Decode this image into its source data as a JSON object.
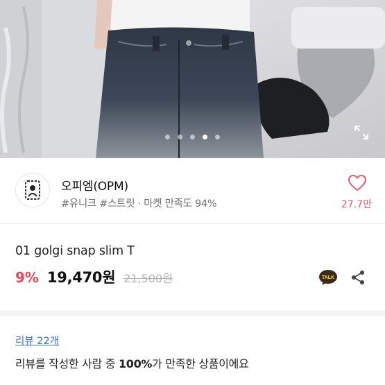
{
  "gallery": {
    "slide_count": 5,
    "active_index": 3,
    "expand_icon": "expand-arrows-icon"
  },
  "shop": {
    "name": "오피엠(OPM)",
    "tags": "#유니크 #스트릿",
    "satisfaction": "마켓 만족도 94%",
    "like_count": "27.7만",
    "like_icon": "heart-outline-icon",
    "colors": {
      "like": "#e45b67"
    }
  },
  "product": {
    "title": "01 golgi snap slim T",
    "discount": "9%",
    "price": "19,470원",
    "original_price": "21,500원",
    "colors": {
      "discount": "#e84a57",
      "original": "#b3b3b3"
    },
    "talk_label": "TALK",
    "share_icon": "share-icon"
  },
  "review": {
    "link_label": "리뷰 22개",
    "summary_prefix": "리뷰를 작성한 사람 중 ",
    "summary_percent": "100%",
    "summary_suffix": "가 만족한 상품이에요",
    "colors": {
      "link": "#3a6fd8"
    }
  }
}
